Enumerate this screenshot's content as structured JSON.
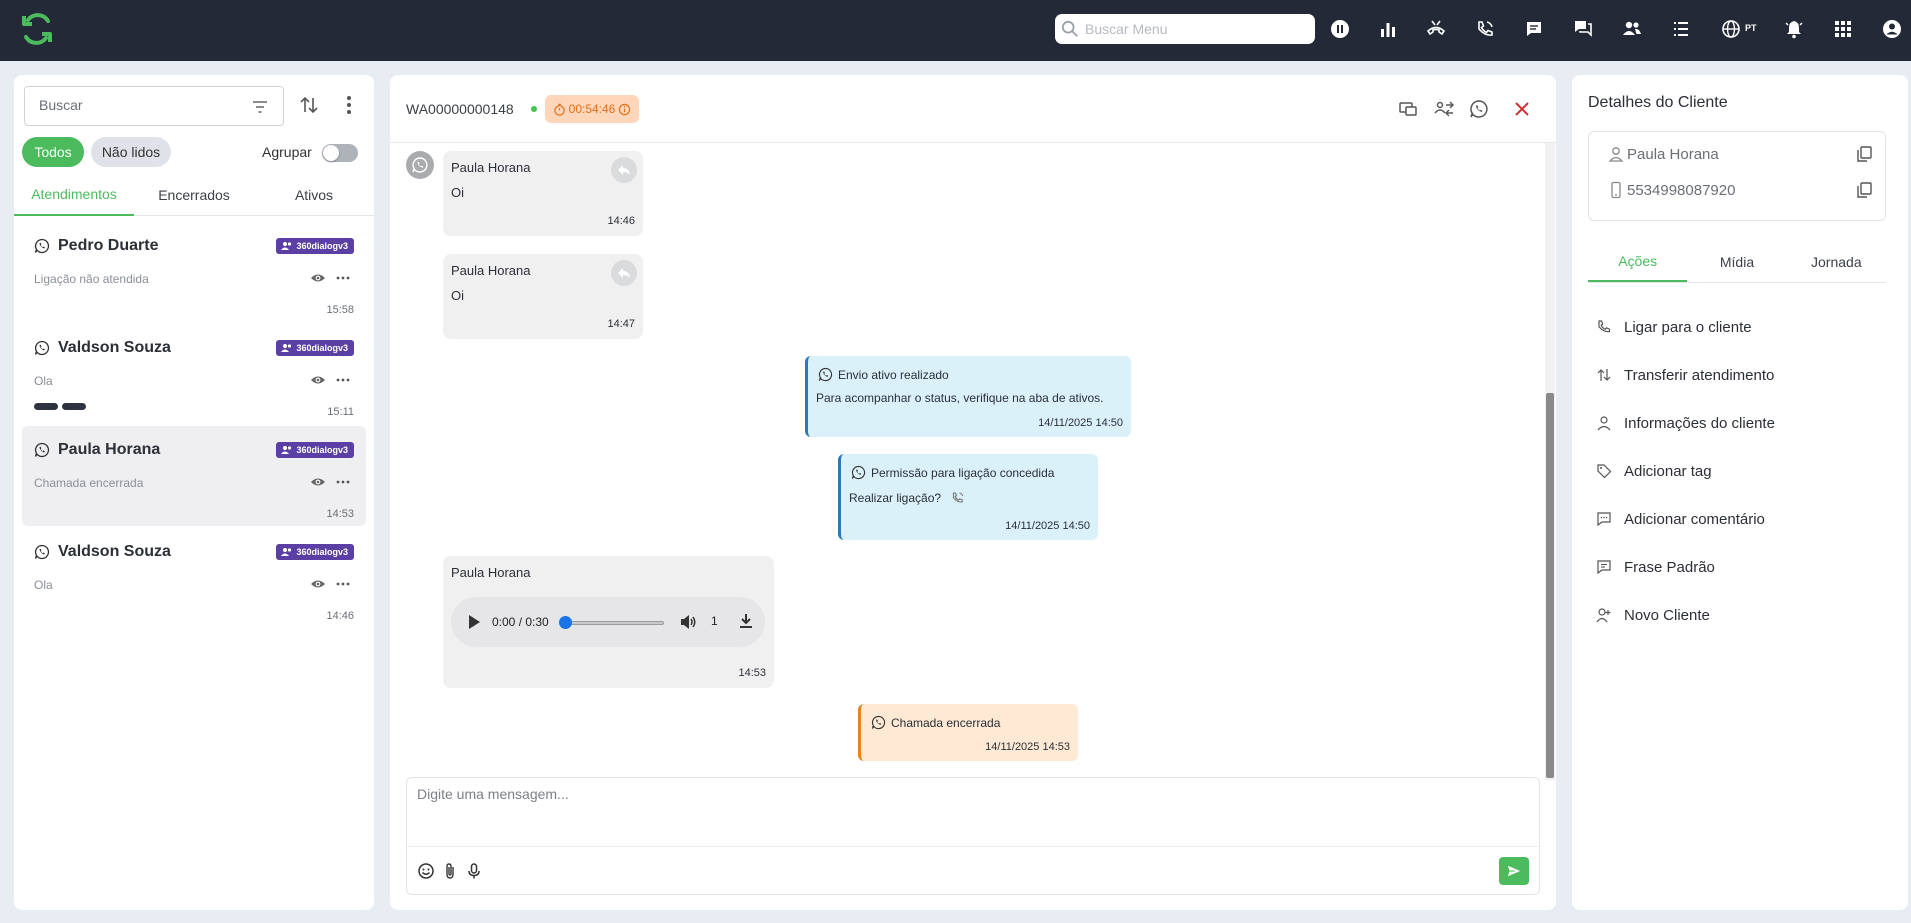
{
  "topbar": {
    "search_placeholder": "Buscar Menu",
    "lang": "PT",
    "icons": [
      "pause-icon",
      "chart-icon",
      "hangup-icon",
      "phone-icon",
      "chat-icon",
      "chats-icon",
      "users-icon",
      "list-icon",
      "globe-icon",
      "bell-icon",
      "apps-icon",
      "account-icon"
    ]
  },
  "sidebar": {
    "search_placeholder": "Buscar",
    "chips": {
      "all": "Todos",
      "unread": "Não lidos"
    },
    "group_label": "Agrupar",
    "tabs": [
      "Atendimentos",
      "Encerrados",
      "Ativos"
    ],
    "conversations": [
      {
        "name": "Pedro Duarte",
        "badge": "360dialogv3",
        "preview": "Ligação não atendida",
        "time": "15:58"
      },
      {
        "name": "Valdson Souza",
        "badge": "360dialogv3",
        "preview": "Ola",
        "time": "15:11"
      },
      {
        "name": "Paula Horana",
        "badge": "360dialogv3",
        "preview": "Chamada encerrada",
        "time": "14:53"
      },
      {
        "name": "Valdson Souza",
        "badge": "360dialogv3",
        "preview": "Ola",
        "time": "14:46"
      }
    ]
  },
  "chat": {
    "id": "WA00000000148",
    "timer": "00:54:46",
    "messages": [
      {
        "author": "Paula Horana",
        "text": "Oi",
        "time": "14:46"
      },
      {
        "author": "Paula Horana",
        "text": "Oi",
        "time": "14:47"
      }
    ],
    "system": [
      {
        "title": "Envio ativo realizado",
        "body": "Para acompanhar o status, verifique na aba de ativos.",
        "time": "14/11/2025 14:50"
      },
      {
        "title": "Permissão para ligação concedida",
        "body": "Realizar ligação?",
        "time": "14/11/2025 14:50"
      },
      {
        "title": "Chamada encerrada",
        "body": "",
        "time": "14/11/2025 14:53"
      }
    ],
    "audio": {
      "author": "Paula Horana",
      "time_label": "0:00 / 0:30",
      "speed": "1",
      "time": "14:53"
    },
    "composer_placeholder": "Digite uma mensagem..."
  },
  "client": {
    "title": "Detalhes do Cliente",
    "name": "Paula Horana",
    "phone": "5534998087920",
    "tabs": [
      "Ações",
      "Mídia",
      "Jornada"
    ],
    "actions": [
      "Ligar para o cliente",
      "Transferir atendimento",
      "Informações do cliente",
      "Adicionar tag",
      "Adicionar comentário",
      "Frase Padrão",
      "Novo Cliente"
    ]
  },
  "colors": {
    "accent": "#4cbb5e",
    "topbar": "#232936",
    "badge": "#5b3fa5",
    "timer": "#e0701c"
  }
}
